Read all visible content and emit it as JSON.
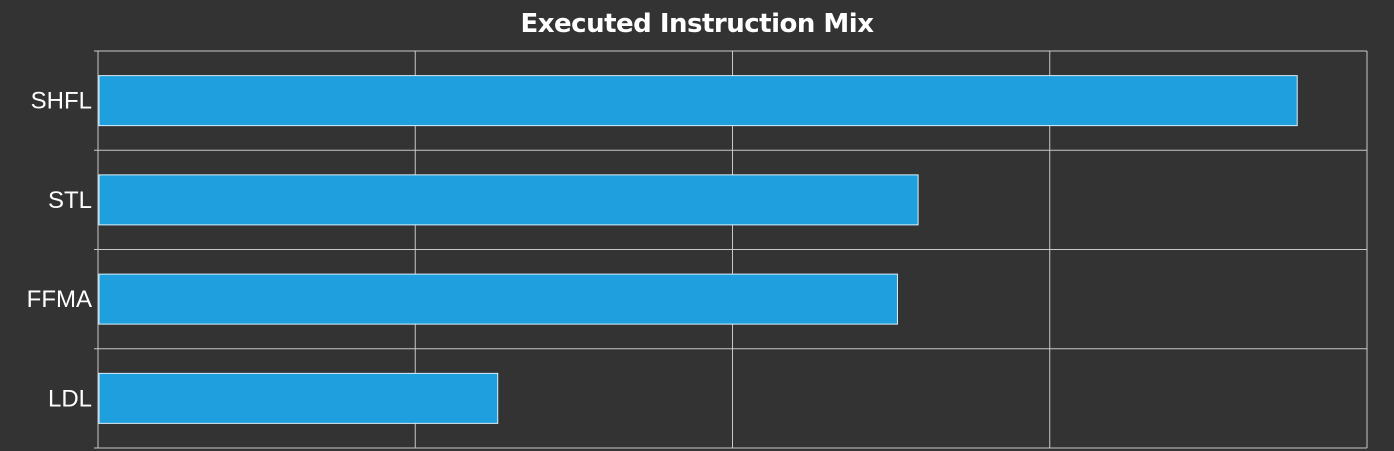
{
  "chart_data": {
    "type": "bar",
    "orientation": "horizontal",
    "title": "Executed Instruction Mix",
    "xlabel": "",
    "ylabel": "",
    "categories": [
      "SHFL",
      "STL",
      "FFMA",
      "LDL"
    ],
    "values": [
      3.78,
      2.585,
      2.52,
      1.26
    ],
    "xlim": [
      0,
      4
    ],
    "x_ticks_shown": false,
    "grid": true,
    "legend": "none"
  },
  "colors": {
    "background": "#333333",
    "bar_fill": "#1f9fde",
    "bar_stroke": "#d9f0fb",
    "grid": "#c8c8c8",
    "text": "#ffffff"
  }
}
